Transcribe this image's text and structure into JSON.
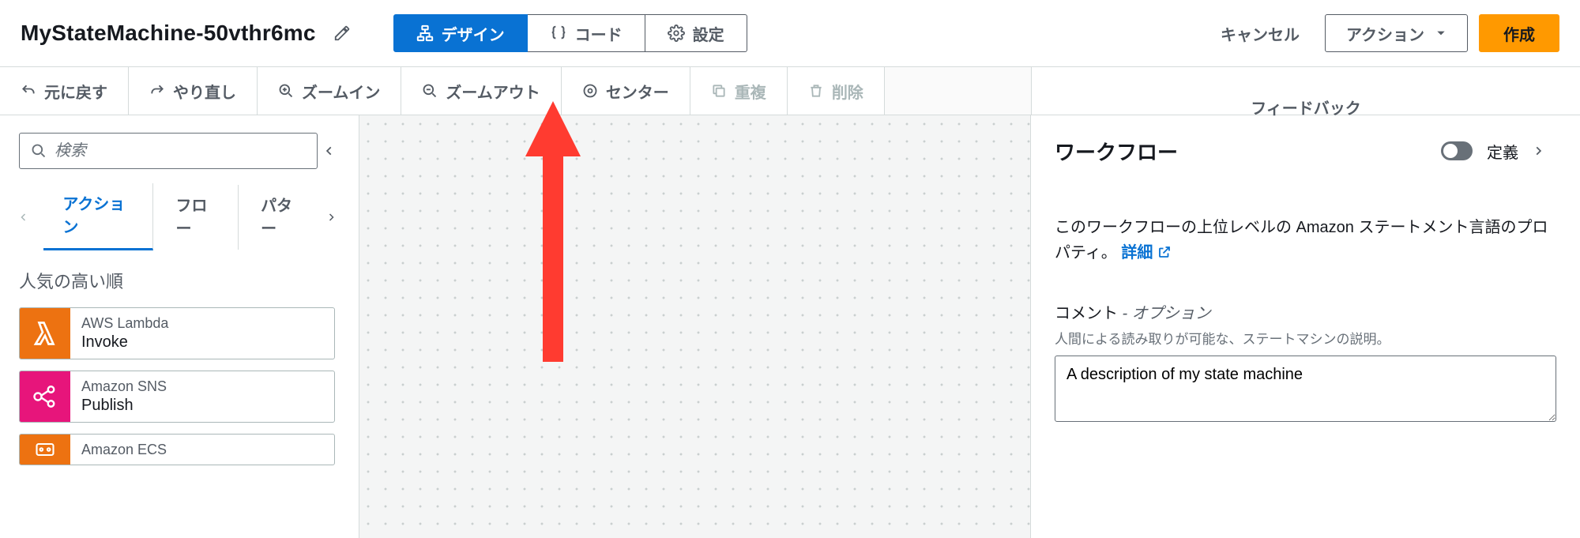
{
  "header": {
    "title": "MyStateMachine-50vthr6mc",
    "tabs": {
      "design": "デザイン",
      "code": "コード",
      "config": "設定"
    },
    "cancel": "キャンセル",
    "actions": "アクション",
    "create": "作成"
  },
  "toolbar": {
    "undo": "元に戻す",
    "redo": "やり直し",
    "zoom_in": "ズームイン",
    "zoom_out": "ズームアウト",
    "center": "センター",
    "duplicate": "重複",
    "delete": "削除",
    "feedback": "フィードバック"
  },
  "left": {
    "search_placeholder": "検索",
    "tabs": {
      "actions": "アクション",
      "flow": "フロー",
      "patterns": "パター"
    },
    "section": "人気の高い順",
    "items": [
      {
        "service": "AWS Lambda",
        "name": "Invoke"
      },
      {
        "service": "Amazon SNS",
        "name": "Publish"
      },
      {
        "service": "Amazon ECS",
        "name": ""
      }
    ]
  },
  "right": {
    "title": "ワークフロー",
    "toggle_label": "定義",
    "description_prefix": "このワークフローの上位レベルの Amazon ステートメント言語のプロパティ。",
    "details_link": "詳細",
    "comment_label": "コメント",
    "comment_optional": " - オプション",
    "comment_help": "人間による読み取りが可能な、ステートマシンの説明。",
    "comment_value": "A description of my state machine"
  }
}
